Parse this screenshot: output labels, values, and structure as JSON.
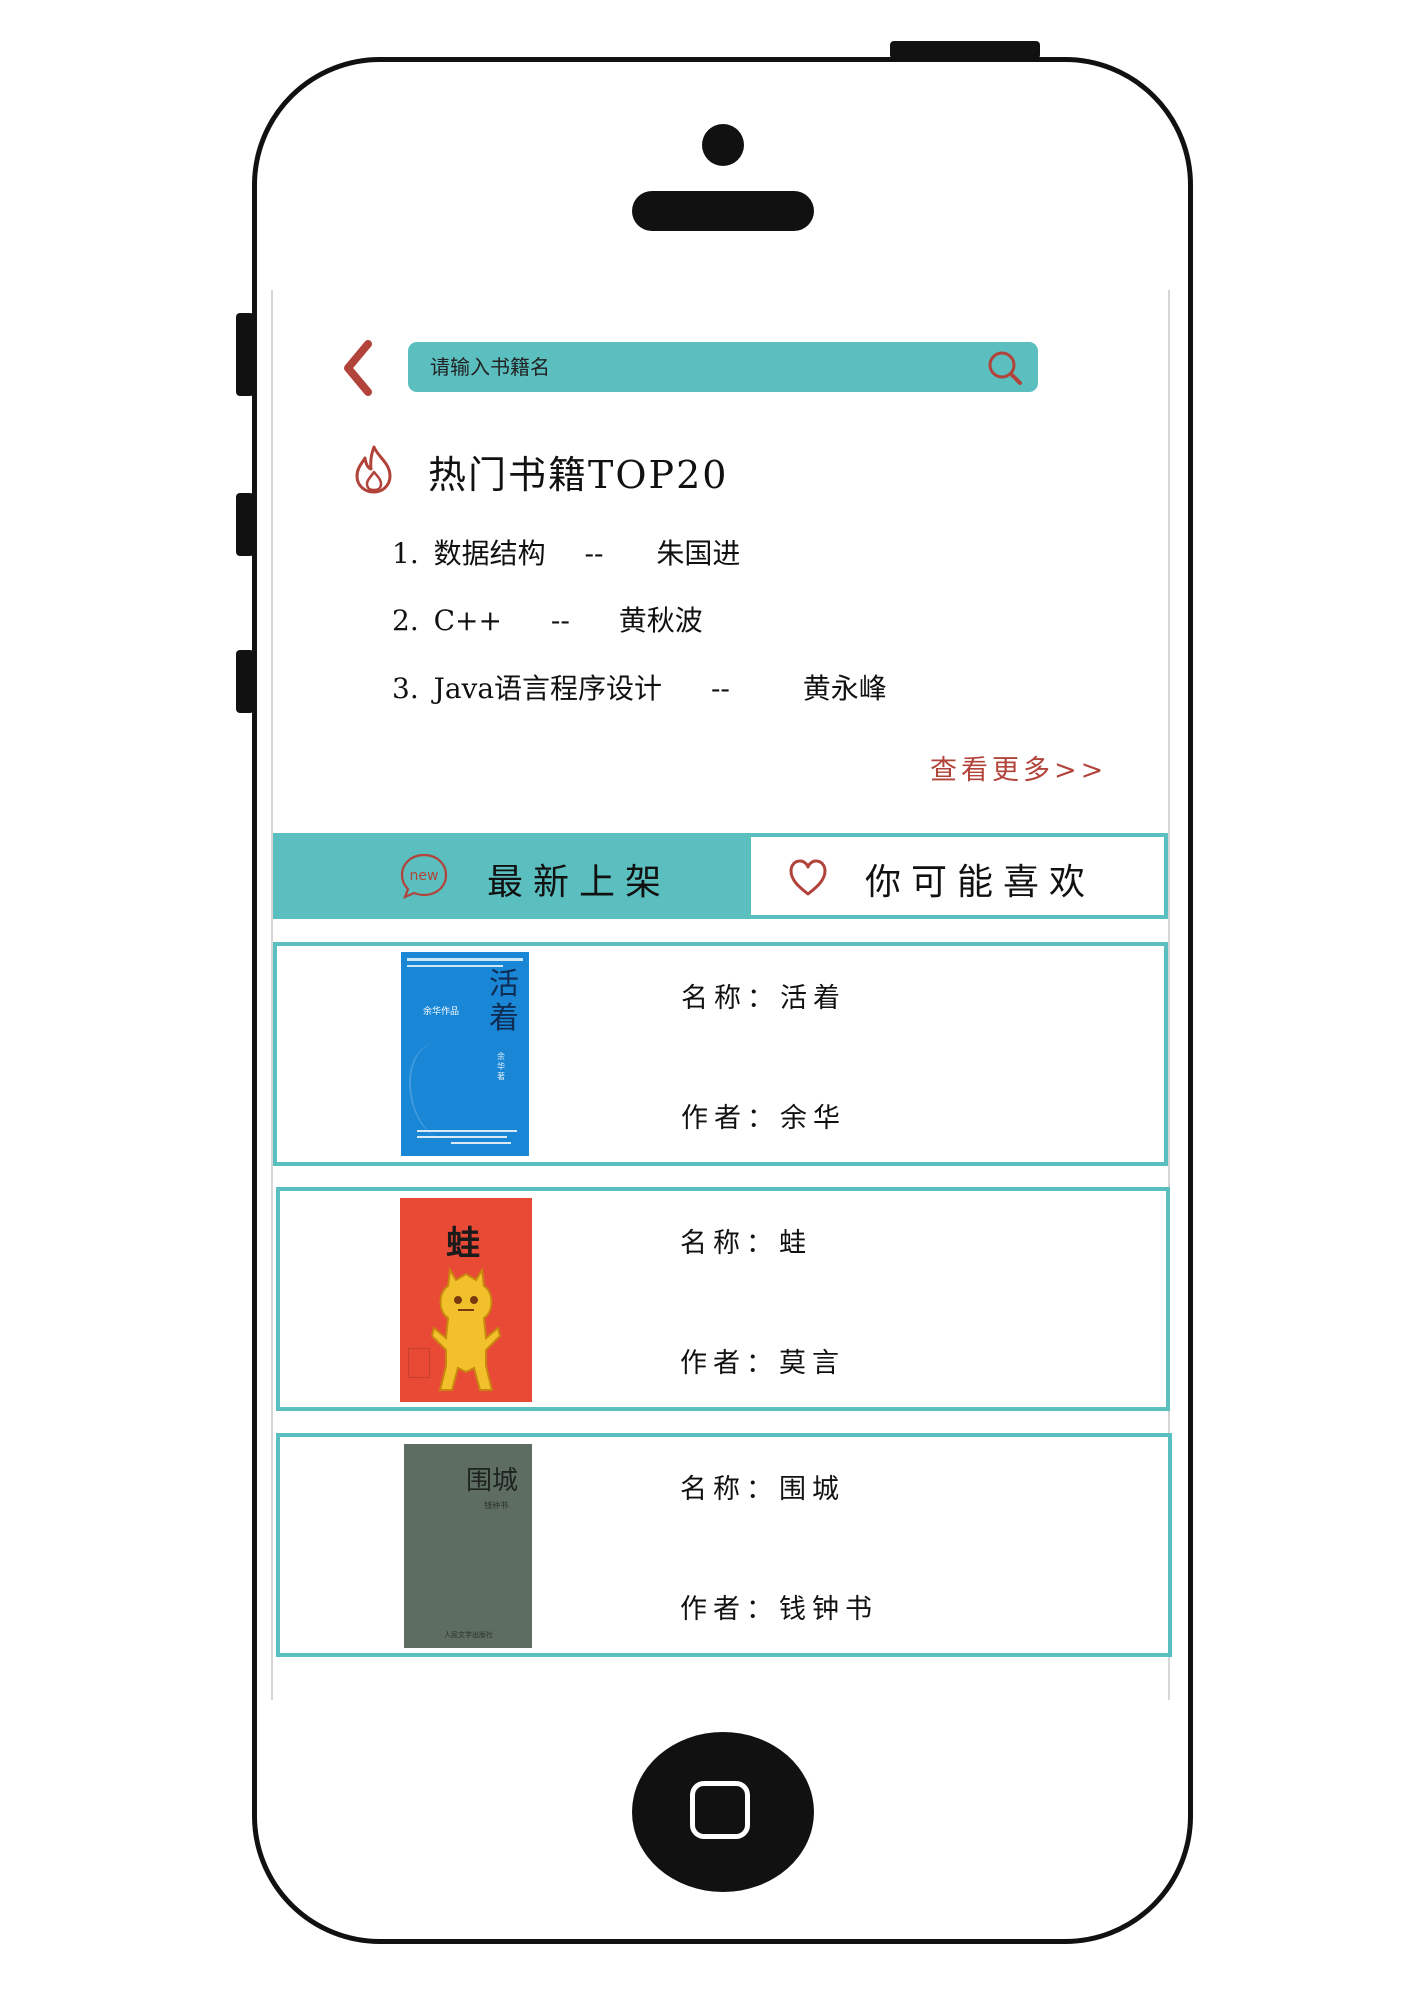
{
  "search": {
    "placeholder": "请输入书籍名"
  },
  "hot": {
    "title": "热门书籍TOP20",
    "items": [
      {
        "rank": "1.",
        "title": "数据结构",
        "sep": "--",
        "author": "朱国进"
      },
      {
        "rank": "2.",
        "title": "C++",
        "sep": "--",
        "author": "黄秋波"
      },
      {
        "rank": "3.",
        "title": "Java语言程序设计",
        "sep": "--",
        "author": "黄永峰"
      }
    ],
    "more": "查看更多>>"
  },
  "tabs": {
    "new_icon_text": "new",
    "new_label": "最新上架",
    "like_label": "你可能喜欢"
  },
  "books": [
    {
      "name_label": "名称：",
      "name": "活着",
      "author_label": "作者：",
      "author": "余华",
      "cover_title": "活着",
      "cover_line1": "余华作品",
      "cover_line2": "余华 著",
      "cover_color": "#1a86d6"
    },
    {
      "name_label": "名称：",
      "name": "蛙",
      "author_label": "作者：",
      "author": "莫言",
      "cover_title": "蛙",
      "cover_color": "#e84a35"
    },
    {
      "name_label": "名称：",
      "name": "围城",
      "author_label": "作者：",
      "author": "钱钟书",
      "cover_title": "围城",
      "cover_line1": "钱钟书",
      "cover_line2": "人民文学出版社",
      "cover_color": "#5d6d62"
    }
  ],
  "colors": {
    "accent": "#5bbfc0",
    "red": "#b2433a",
    "frame": "#111111"
  }
}
